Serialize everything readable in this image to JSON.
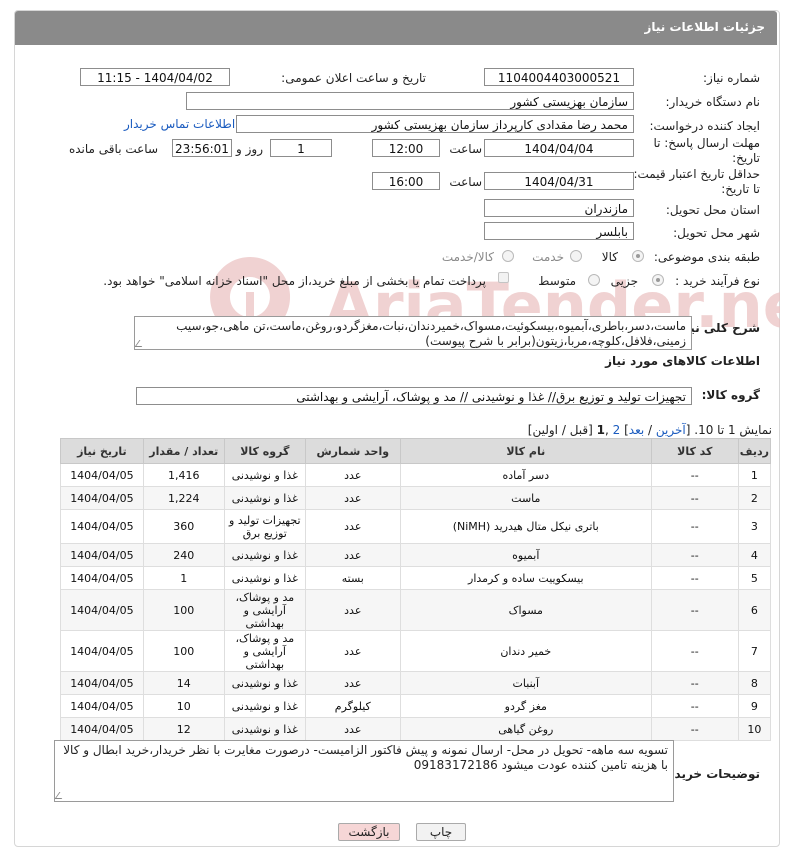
{
  "header": {
    "title": "جزئیات اطلاعات نیاز"
  },
  "form": {
    "need_number_label": "شماره نیاز:",
    "need_number": "1104004403000521",
    "announce_label": "تاریخ و ساعت اعلان عمومی:",
    "announce_value": "1404/04/02 - 11:15",
    "buyer_org_label": "نام دستگاه خریدار:",
    "buyer_org": "سازمان بهزیستی کشور",
    "creator_label": "ایجاد کننده درخواست:",
    "creator": "محمد رضا  مقدادی کارپرداز سازمان بهزیستی کشور",
    "contact_link": "اطلاعات تماس خریدار",
    "deadline_label_1": "مهلت ارسال پاسخ: تا",
    "deadline_label_2": "تاریخ:",
    "deadline_date": "1404/04/04",
    "time_label": "ساعت",
    "deadline_time": "12:00",
    "days_value": "1",
    "days_label": "روز و",
    "remaining_time": "23:56:01",
    "remaining_label": "ساعت باقی مانده",
    "min_valid_label_1": "حداقل تاریخ اعتبار قیمت:",
    "min_valid_label_2": "تا تاریخ:",
    "min_valid_date": "1404/04/31",
    "min_valid_time": "16:00",
    "province_label": "استان محل تحویل:",
    "province": "مازندران",
    "city_label": "شهر محل تحویل:",
    "city": "بابلسر",
    "category_label": "طبقه بندی موضوعی:",
    "category_options": [
      "کالا",
      "خدمت",
      "کالا/خدمت"
    ],
    "process_label": "نوع فرآیند خرید :",
    "process_options": [
      "جزیی",
      "متوسط"
    ],
    "payment_note": "پرداخت تمام یا بخشی از مبلغ خرید،از محل \"اسناد خزانه اسلامی\" خواهد بود."
  },
  "summary": {
    "label": "شرح کلی نیاز:",
    "text": "ماست،دسر،باطری،آبمیوه،بیسکوئیت،مسواک،خمیردندان،نبات،مغزگردو،روغن،ماست،تن ماهی،جو،سیب زمینی،فلافل،کلوچه،مربا،زیتون(برابر با شرح پیوست)"
  },
  "items_section": {
    "title": "اطلاعات کالاهای مورد نیاز",
    "group_label": "گروه کالا:",
    "group_value": "تجهیزات تولید و توزیع برق// غذا و نوشیدنی // مد و پوشاک، آرایشی و بهداشتی"
  },
  "pagination": {
    "prefix": "نمایش 1 تا 10. [",
    "last": "آخرین",
    "sep1": " / ",
    "next": "بعد",
    "bracket_close": "] ",
    "page2": "2",
    "comma": " ,",
    "page1": "1",
    "suffix": " [قبل / اولین]"
  },
  "table": {
    "headers": [
      "ردیف",
      "کد کالا",
      "نام کالا",
      "واحد شمارش",
      "گروه کالا",
      "تعداد / مقدار",
      "تاریخ نیاز"
    ],
    "rows": [
      {
        "n": "1",
        "code": "--",
        "name": "دسر آماده",
        "unit": "عدد",
        "group": "غذا و نوشیدنی",
        "qty": "1,416",
        "date": "1404/04/05"
      },
      {
        "n": "2",
        "code": "--",
        "name": "ماست",
        "unit": "عدد",
        "group": "غذا و نوشیدنی",
        "qty": "1,224",
        "date": "1404/04/05"
      },
      {
        "n": "3",
        "code": "--",
        "name": "باتری نیکل متال هیدرید (NiMH)",
        "unit": "عدد",
        "group": "تجهیزات تولید و توزیع برق",
        "qty": "360",
        "date": "1404/04/05"
      },
      {
        "n": "4",
        "code": "--",
        "name": "آبمیوه",
        "unit": "عدد",
        "group": "غذا و نوشیدنی",
        "qty": "240",
        "date": "1404/04/05"
      },
      {
        "n": "5",
        "code": "--",
        "name": "بیسکوییت ساده و کرمدار",
        "unit": "بسته",
        "group": "غذا و نوشیدنی",
        "qty": "1",
        "date": "1404/04/05"
      },
      {
        "n": "6",
        "code": "--",
        "name": "مسواک",
        "unit": "عدد",
        "group": "مد و پوشاک، آرایشی و بهداشتی",
        "qty": "100",
        "date": "1404/04/05"
      },
      {
        "n": "7",
        "code": "--",
        "name": "خمیر دندان",
        "unit": "عدد",
        "group": "مد و پوشاک، آرایشی و بهداشتی",
        "qty": "100",
        "date": "1404/04/05"
      },
      {
        "n": "8",
        "code": "--",
        "name": "آبنبات",
        "unit": "عدد",
        "group": "غذا و نوشیدنی",
        "qty": "14",
        "date": "1404/04/05"
      },
      {
        "n": "9",
        "code": "--",
        "name": "مغز گردو",
        "unit": "کیلوگرم",
        "group": "غذا و نوشیدنی",
        "qty": "10",
        "date": "1404/04/05"
      },
      {
        "n": "10",
        "code": "--",
        "name": "روغن گیاهی",
        "unit": "عدد",
        "group": "غذا و نوشیدنی",
        "qty": "12",
        "date": "1404/04/05"
      }
    ]
  },
  "buyer_notes": {
    "label": "توضیحات خریدار:",
    "text": "تسویه سه ماهه- تحویل در محل- ارسال نمونه و پیش فاکتور الزامیست- درصورت مغایرت با نظر خریدار،خرید ابطال و کالا با هزینه تامین کننده عودت میشود 09183172186"
  },
  "buttons": {
    "print": "چاپ",
    "back": "بازگشت"
  },
  "watermark": {
    "text": "AriaTender.neT"
  },
  "colors": {
    "header_bg": "#8a8a8a",
    "link": "#1a5bbf",
    "back_btn_bg": "#f6d6d6",
    "watermark": "#e7b8b8"
  }
}
